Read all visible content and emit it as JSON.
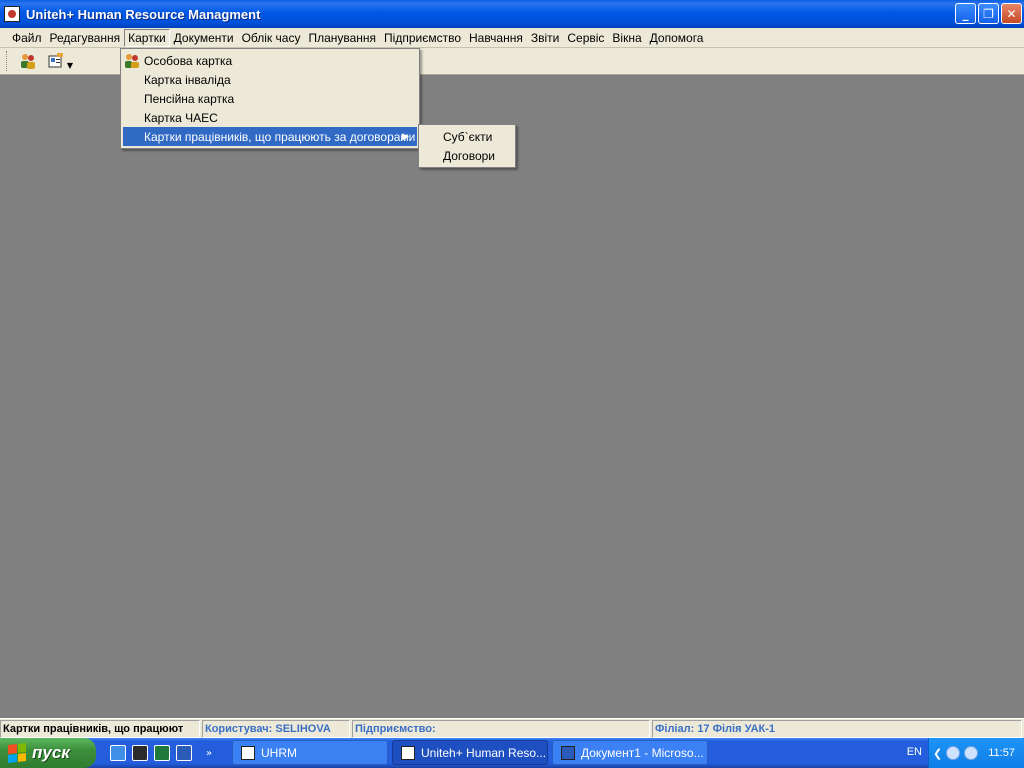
{
  "window": {
    "title": "Uniteh+ Human Resource Managment",
    "buttons": {
      "minimize": "_",
      "maximize": "❐",
      "close": "✕"
    }
  },
  "menubar": {
    "items": [
      {
        "label": "Файл"
      },
      {
        "label": "Редагування"
      },
      {
        "label": "Картки"
      },
      {
        "label": "Документи"
      },
      {
        "label": "Облік часу"
      },
      {
        "label": "Планування"
      },
      {
        "label": "Підприємство"
      },
      {
        "label": "Навчання"
      },
      {
        "label": "Звіти"
      },
      {
        "label": "Сервіс"
      },
      {
        "label": "Вікна"
      },
      {
        "label": "Допомога"
      }
    ],
    "active_index": 2
  },
  "toolbar": {
    "buttons": [
      {
        "icon": "people-icon"
      },
      {
        "icon": "card-dropdown-icon"
      }
    ]
  },
  "cards_menu": {
    "items": [
      {
        "label": "Особова картка",
        "icon": "people-icon"
      },
      {
        "label": "Картка інваліда"
      },
      {
        "label": "Пенсійна картка"
      },
      {
        "label": "Картка ЧАЕС"
      },
      {
        "label": "Картки працівників, що працюють за договорами",
        "submenu_arrow": "▶"
      }
    ],
    "selected_index": 4
  },
  "contracts_submenu": {
    "items": [
      {
        "label": "Суб`єкти"
      },
      {
        "label": "Договори"
      }
    ]
  },
  "statusbar": {
    "hint": "Картки працівників, що працюют",
    "user": "Користувач: SELIHOVA",
    "enterprise": "Підприємство:",
    "branch": "Філіал: 17 Філія УАК-1"
  },
  "taskbar": {
    "start_label": "пуск",
    "quick_launch": [
      "ie-icon",
      "app-icon",
      "excel-icon",
      "word-icon"
    ],
    "quick_chevron": "»",
    "tasks": [
      {
        "label": "UHRM"
      },
      {
        "label": "Uniteh+ Human Reso..."
      },
      {
        "label": "Документ1 - Microso..."
      }
    ],
    "language": "EN",
    "tray_chevron": "❮",
    "clock": "11:57"
  },
  "colors": {
    "titlebar": "#0058e6",
    "menu_highlight": "#316ac5",
    "workspace": "#808080",
    "status_blue": "#3a6fc4"
  }
}
